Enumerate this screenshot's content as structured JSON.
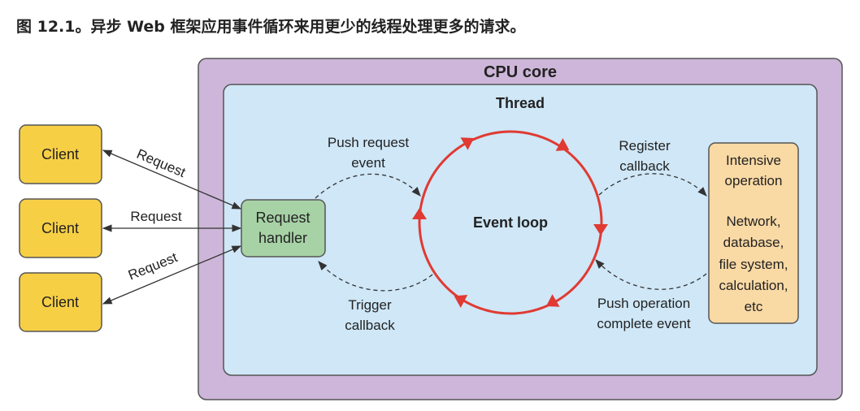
{
  "caption": "图 12.1。异步 Web 框架应用事件循环来用更少的线程处理更多的请求。",
  "cpu_core": {
    "title": "CPU core"
  },
  "thread": {
    "title": "Thread"
  },
  "clients": [
    {
      "label": "Client"
    },
    {
      "label": "Client"
    },
    {
      "label": "Client"
    }
  ],
  "request_arrows": [
    {
      "label": "Request"
    },
    {
      "label": "Request"
    },
    {
      "label": "Request"
    }
  ],
  "request_handler": {
    "line1": "Request",
    "line2": "handler"
  },
  "event_loop": {
    "label": "Event loop"
  },
  "push_request_event": {
    "line1": "Push request",
    "line2": "event"
  },
  "trigger_callback": {
    "line1": "Trigger",
    "line2": "callback"
  },
  "register_callback": {
    "line1": "Register",
    "line2": "callback"
  },
  "push_operation_event": {
    "line1": "Push operation",
    "line2": "complete event"
  },
  "intensive_operation": {
    "lines": [
      "Intensive",
      "operation",
      "",
      "Network,",
      "database,",
      "file system,",
      "calculation,",
      "etc"
    ]
  },
  "colors": {
    "cpu_fill": "#cdb6d9",
    "thread_fill": "#cfe7f7",
    "client_fill": "#f7cf45",
    "handler_fill": "#a7d2a6",
    "intensive_fill": "#f9d9a4",
    "loop_red": "#e03a32"
  }
}
